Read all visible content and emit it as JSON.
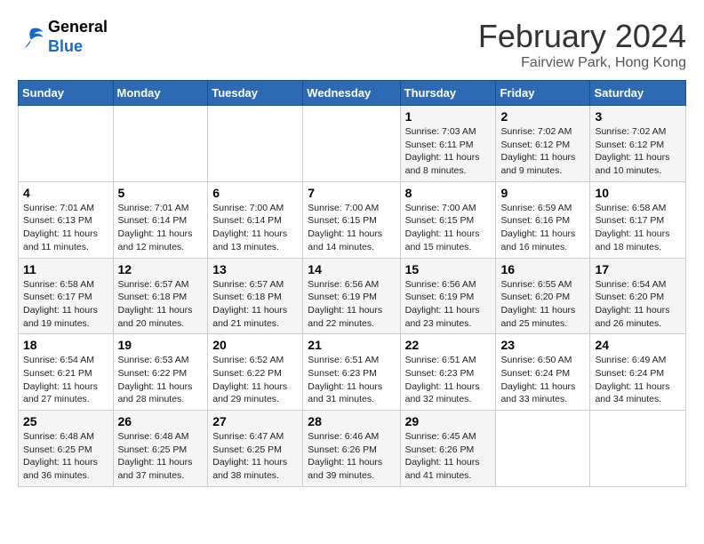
{
  "header": {
    "logo_general": "General",
    "logo_blue": "Blue",
    "month_year": "February 2024",
    "location": "Fairview Park, Hong Kong"
  },
  "days_of_week": [
    "Sunday",
    "Monday",
    "Tuesday",
    "Wednesday",
    "Thursday",
    "Friday",
    "Saturday"
  ],
  "weeks": [
    [
      {
        "day": "",
        "info": ""
      },
      {
        "day": "",
        "info": ""
      },
      {
        "day": "",
        "info": ""
      },
      {
        "day": "",
        "info": ""
      },
      {
        "day": "1",
        "info": "Sunrise: 7:03 AM\nSunset: 6:11 PM\nDaylight: 11 hours\nand 8 minutes."
      },
      {
        "day": "2",
        "info": "Sunrise: 7:02 AM\nSunset: 6:12 PM\nDaylight: 11 hours\nand 9 minutes."
      },
      {
        "day": "3",
        "info": "Sunrise: 7:02 AM\nSunset: 6:12 PM\nDaylight: 11 hours\nand 10 minutes."
      }
    ],
    [
      {
        "day": "4",
        "info": "Sunrise: 7:01 AM\nSunset: 6:13 PM\nDaylight: 11 hours\nand 11 minutes."
      },
      {
        "day": "5",
        "info": "Sunrise: 7:01 AM\nSunset: 6:14 PM\nDaylight: 11 hours\nand 12 minutes."
      },
      {
        "day": "6",
        "info": "Sunrise: 7:00 AM\nSunset: 6:14 PM\nDaylight: 11 hours\nand 13 minutes."
      },
      {
        "day": "7",
        "info": "Sunrise: 7:00 AM\nSunset: 6:15 PM\nDaylight: 11 hours\nand 14 minutes."
      },
      {
        "day": "8",
        "info": "Sunrise: 7:00 AM\nSunset: 6:15 PM\nDaylight: 11 hours\nand 15 minutes."
      },
      {
        "day": "9",
        "info": "Sunrise: 6:59 AM\nSunset: 6:16 PM\nDaylight: 11 hours\nand 16 minutes."
      },
      {
        "day": "10",
        "info": "Sunrise: 6:58 AM\nSunset: 6:17 PM\nDaylight: 11 hours\nand 18 minutes."
      }
    ],
    [
      {
        "day": "11",
        "info": "Sunrise: 6:58 AM\nSunset: 6:17 PM\nDaylight: 11 hours\nand 19 minutes."
      },
      {
        "day": "12",
        "info": "Sunrise: 6:57 AM\nSunset: 6:18 PM\nDaylight: 11 hours\nand 20 minutes."
      },
      {
        "day": "13",
        "info": "Sunrise: 6:57 AM\nSunset: 6:18 PM\nDaylight: 11 hours\nand 21 minutes."
      },
      {
        "day": "14",
        "info": "Sunrise: 6:56 AM\nSunset: 6:19 PM\nDaylight: 11 hours\nand 22 minutes."
      },
      {
        "day": "15",
        "info": "Sunrise: 6:56 AM\nSunset: 6:19 PM\nDaylight: 11 hours\nand 23 minutes."
      },
      {
        "day": "16",
        "info": "Sunrise: 6:55 AM\nSunset: 6:20 PM\nDaylight: 11 hours\nand 25 minutes."
      },
      {
        "day": "17",
        "info": "Sunrise: 6:54 AM\nSunset: 6:20 PM\nDaylight: 11 hours\nand 26 minutes."
      }
    ],
    [
      {
        "day": "18",
        "info": "Sunrise: 6:54 AM\nSunset: 6:21 PM\nDaylight: 11 hours\nand 27 minutes."
      },
      {
        "day": "19",
        "info": "Sunrise: 6:53 AM\nSunset: 6:22 PM\nDaylight: 11 hours\nand 28 minutes."
      },
      {
        "day": "20",
        "info": "Sunrise: 6:52 AM\nSunset: 6:22 PM\nDaylight: 11 hours\nand 29 minutes."
      },
      {
        "day": "21",
        "info": "Sunrise: 6:51 AM\nSunset: 6:23 PM\nDaylight: 11 hours\nand 31 minutes."
      },
      {
        "day": "22",
        "info": "Sunrise: 6:51 AM\nSunset: 6:23 PM\nDaylight: 11 hours\nand 32 minutes."
      },
      {
        "day": "23",
        "info": "Sunrise: 6:50 AM\nSunset: 6:24 PM\nDaylight: 11 hours\nand 33 minutes."
      },
      {
        "day": "24",
        "info": "Sunrise: 6:49 AM\nSunset: 6:24 PM\nDaylight: 11 hours\nand 34 minutes."
      }
    ],
    [
      {
        "day": "25",
        "info": "Sunrise: 6:48 AM\nSunset: 6:25 PM\nDaylight: 11 hours\nand 36 minutes."
      },
      {
        "day": "26",
        "info": "Sunrise: 6:48 AM\nSunset: 6:25 PM\nDaylight: 11 hours\nand 37 minutes."
      },
      {
        "day": "27",
        "info": "Sunrise: 6:47 AM\nSunset: 6:25 PM\nDaylight: 11 hours\nand 38 minutes."
      },
      {
        "day": "28",
        "info": "Sunrise: 6:46 AM\nSunset: 6:26 PM\nDaylight: 11 hours\nand 39 minutes."
      },
      {
        "day": "29",
        "info": "Sunrise: 6:45 AM\nSunset: 6:26 PM\nDaylight: 11 hours\nand 41 minutes."
      },
      {
        "day": "",
        "info": ""
      },
      {
        "day": "",
        "info": ""
      }
    ]
  ]
}
